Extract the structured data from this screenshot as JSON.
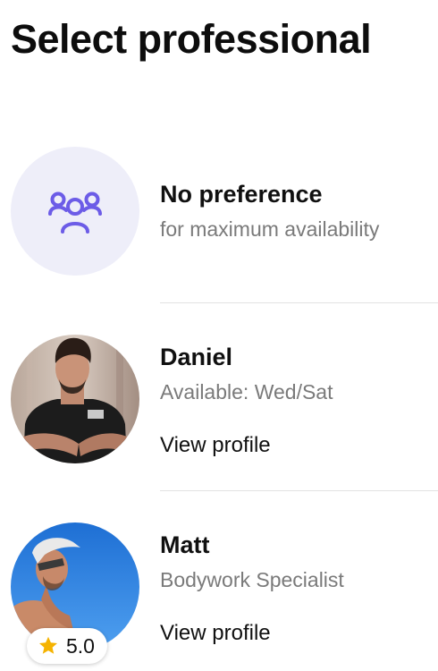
{
  "page": {
    "title": "Select professional"
  },
  "professionals": [
    {
      "name": "No preference",
      "subtitle": "for maximum availability",
      "icon": "group-people-icon",
      "accent": "#6c5ce7"
    },
    {
      "name": "Daniel",
      "subtitle": "Available: Wed/Sat",
      "link": "View profile"
    },
    {
      "name": "Matt",
      "subtitle": "Bodywork Specialist",
      "link": "View profile",
      "rating": "5.0",
      "rating_icon": "star-icon"
    }
  ],
  "colors": {
    "accent": "#6c5ce7",
    "star": "#f5b301",
    "muted_text": "#7a7a7a",
    "placeholder_bg": "#eeeef9"
  }
}
